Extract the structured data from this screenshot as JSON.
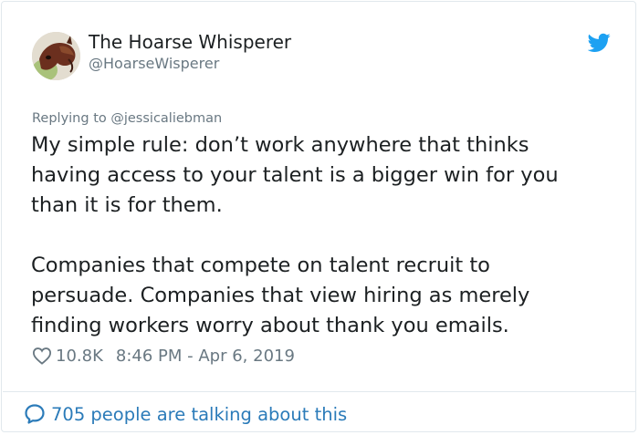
{
  "author": {
    "display_name": "The Hoarse Whisperer",
    "handle": "@HoarseWisperer",
    "avatar_icon": "horse-avatar"
  },
  "reply_to": "Replying to @jessicaliebman",
  "tweet": {
    "paragraph1_lines": [
      "My simple rule: don’t work anywhere that thinks",
      "having access to your talent is a bigger win for you",
      "than it is for them."
    ],
    "paragraph2_lines": [
      "Companies that compete on talent recruit to",
      "persuade. Companies that view hiring as merely",
      "finding workers worry about thank you emails."
    ]
  },
  "meta": {
    "likes": "10.8K",
    "timestamp": "8:46 PM - Apr 6, 2019"
  },
  "footer": {
    "conversation_label": "705 people are talking about this"
  },
  "colors": {
    "twitter_blue": "#1da1f2",
    "link_blue": "#2b7bb9",
    "muted_gray": "#697882",
    "border": "#e1e8ed"
  }
}
